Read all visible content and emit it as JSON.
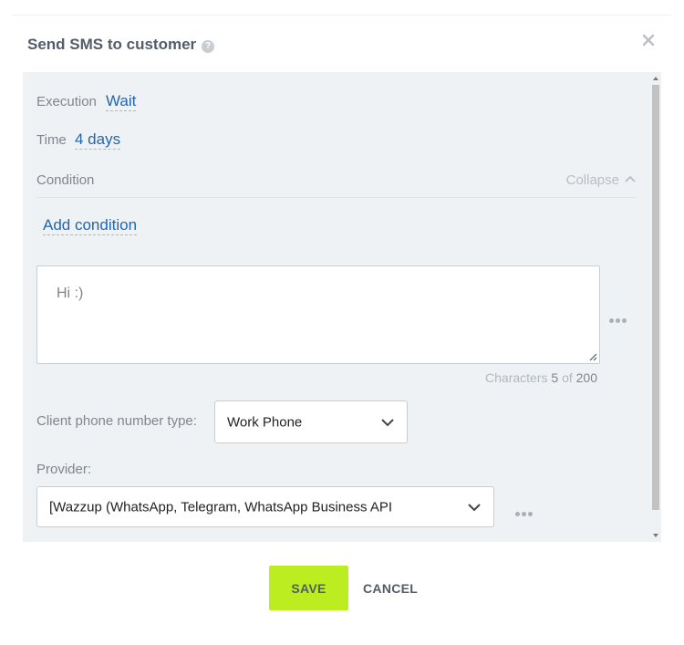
{
  "dialog": {
    "title": "Send SMS to customer",
    "help_icon": "question-circle-icon",
    "close_icon": "close-icon"
  },
  "execution": {
    "label": "Execution",
    "value": "Wait"
  },
  "time": {
    "label": "Time",
    "value": "4 days"
  },
  "condition": {
    "label": "Condition",
    "collapse_label": "Collapse",
    "add_label": "Add condition"
  },
  "message": {
    "text": "Hi :)",
    "counter_label": "Characters",
    "counter_count": "5",
    "counter_of": "of",
    "counter_max": "200"
  },
  "phone_type": {
    "label": "Client phone number type:",
    "selected": "Work Phone"
  },
  "provider": {
    "label": "Provider:",
    "selected": "[Wazzup (WhatsApp, Telegram, WhatsApp Business API"
  },
  "footer": {
    "save_label": "SAVE",
    "cancel_label": "CANCEL"
  },
  "colors": {
    "accent": "#bbed21",
    "link": "#2066b0",
    "panel_bg": "#eef2f4"
  }
}
